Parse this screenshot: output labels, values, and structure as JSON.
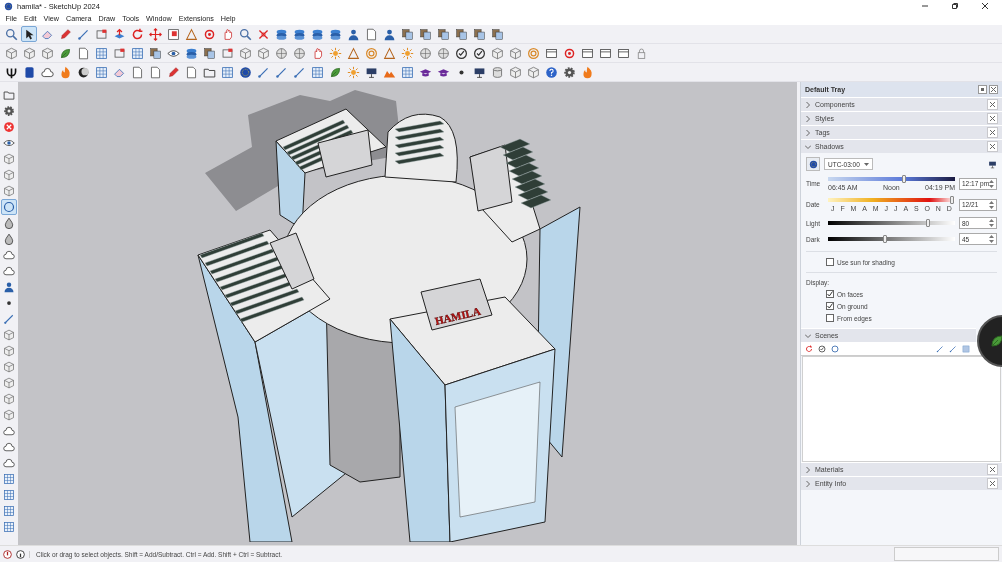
{
  "window": {
    "title": "hamila* - SketchUp 2024"
  },
  "menu": [
    "File",
    "Edit",
    "View",
    "Camera",
    "Draw",
    "Tools",
    "Window",
    "Extensions",
    "Help"
  ],
  "toolbars": {
    "main": [
      {
        "selected": false
      },
      {
        "selected": true
      },
      {
        "selected": false
      },
      {
        "selected": false
      },
      {
        "selected": false
      },
      {
        "selected": false
      },
      {
        "selected": false
      },
      {
        "selected": false
      },
      {
        "selected": false
      },
      {
        "selected": false
      },
      {
        "selected": false
      },
      {
        "selected": false
      },
      {
        "selected": false
      },
      {
        "selected": false
      },
      {
        "selected": false
      },
      {
        "selected": false
      },
      {
        "selected": false
      },
      {
        "selected": false
      },
      {
        "selected": false
      },
      {
        "selected": false
      },
      {
        "selected": false
      },
      {
        "selected": false
      },
      {
        "selected": false
      },
      {
        "selected": false
      },
      {
        "selected": false
      },
      {
        "selected": false
      },
      {
        "selected": false
      },
      {
        "selected": false
      }
    ],
    "side": [
      {
        "selected": false
      },
      {
        "selected": false
      },
      {
        "selected": false
      },
      {
        "selected": false
      },
      {
        "selected": false
      },
      {
        "selected": false
      },
      {
        "selected": false
      },
      {
        "selected": true
      },
      {
        "selected": false
      },
      {
        "selected": false
      },
      {
        "selected": false
      },
      {
        "selected": false
      },
      {
        "selected": false
      },
      {
        "selected": false
      },
      {
        "selected": false
      },
      {
        "selected": false
      },
      {
        "selected": false
      },
      {
        "selected": false
      },
      {
        "selected": false
      },
      {
        "selected": false
      },
      {
        "selected": false
      },
      {
        "selected": false
      },
      {
        "selected": false
      },
      {
        "selected": false
      },
      {
        "selected": false
      },
      {
        "selected": false
      },
      {
        "selected": false
      },
      {
        "selected": false
      }
    ]
  },
  "viewport": {
    "model_label": "HAMILA"
  },
  "tray": {
    "title": "Default Tray",
    "panels": [
      {
        "name": "Components",
        "expanded": false,
        "kind": "plain"
      },
      {
        "name": "Styles",
        "expanded": false,
        "kind": "plain"
      },
      {
        "name": "Tags",
        "expanded": false,
        "kind": "plain"
      },
      {
        "name": "Shadows",
        "expanded": true,
        "kind": "shadows"
      },
      {
        "name": "Scenes",
        "expanded": true,
        "kind": "scenes"
      },
      {
        "name": "Materials",
        "expanded": false,
        "kind": "plain"
      },
      {
        "name": "Entity Info",
        "expanded": false,
        "kind": "plain"
      }
    ],
    "shadows": {
      "timezone": "UTC-03:00",
      "time": {
        "label": "Time",
        "level": 0.6,
        "start": "06:45 AM",
        "middle": "Noon",
        "end": "04:19 PM",
        "value": "12:17 pm"
      },
      "date": {
        "label": "Date",
        "level": 0.98,
        "months": [
          "J",
          "F",
          "M",
          "A",
          "M",
          "J",
          "J",
          "A",
          "S",
          "O",
          "N",
          "D"
        ],
        "value": "12/21"
      },
      "light": {
        "label": "Light",
        "level": 0.79,
        "value": "80"
      },
      "dark": {
        "label": "Dark",
        "level": 0.45,
        "value": "45"
      },
      "use_sun": {
        "label": "Use sun for shading",
        "checked": false
      },
      "display_label": "Display:",
      "display": [
        {
          "label": "On faces",
          "checked": true
        },
        {
          "label": "On ground",
          "checked": true
        },
        {
          "label": "From edges",
          "checked": false
        }
      ]
    }
  },
  "status_bar": {
    "message": "Click or drag to select objects. Shift = Add/Subtract. Ctrl = Add. Shift + Ctrl = Subtract."
  }
}
